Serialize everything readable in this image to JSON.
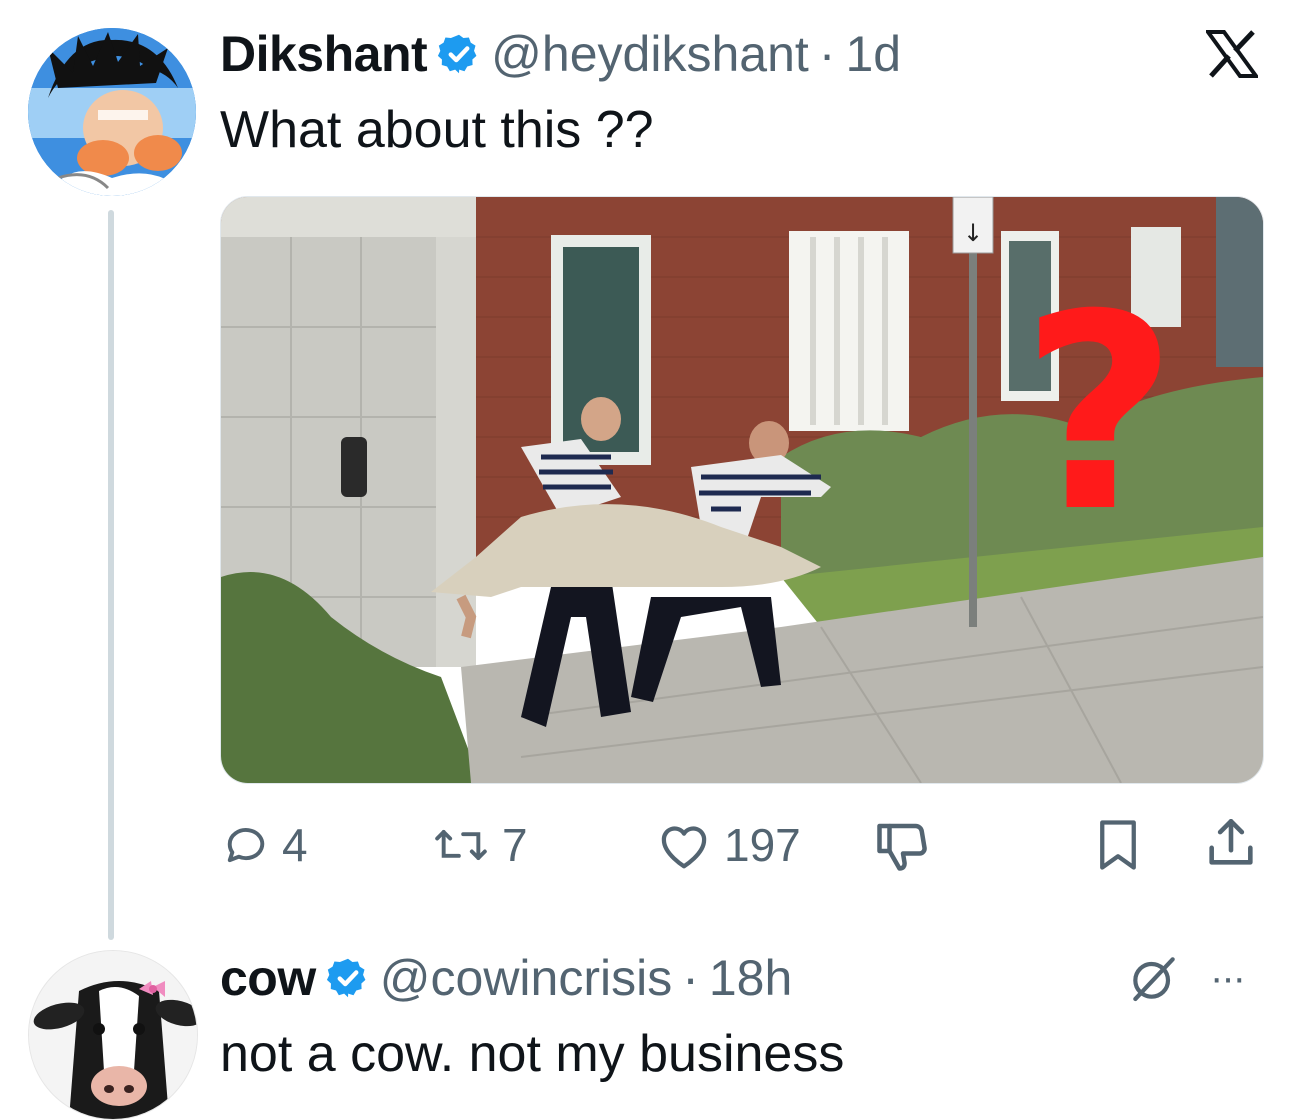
{
  "tweet1": {
    "display_name": "Dikshant",
    "handle": "@heydikshant",
    "separator": "·",
    "time": "1d",
    "text": "What about this ??",
    "avatar_icon": "anime-avatar-icon",
    "media": {
      "alt_icon": "photo-icon",
      "overlay_mark": "?",
      "overlay_color": "#ff1a1a",
      "sign_glyph": "↓"
    },
    "actions": {
      "replies": "4",
      "retweets": "7",
      "likes": "197"
    }
  },
  "tweet2": {
    "display_name": "cow",
    "handle": "@cowincrisis",
    "separator": "·",
    "time": "18h",
    "text": "not a cow. not my business",
    "avatar_icon": "cow-avatar-icon",
    "more": "···"
  },
  "colors": {
    "verified": "#1d9bf0",
    "muted": "#536471",
    "thread_line": "#cfd9de"
  }
}
